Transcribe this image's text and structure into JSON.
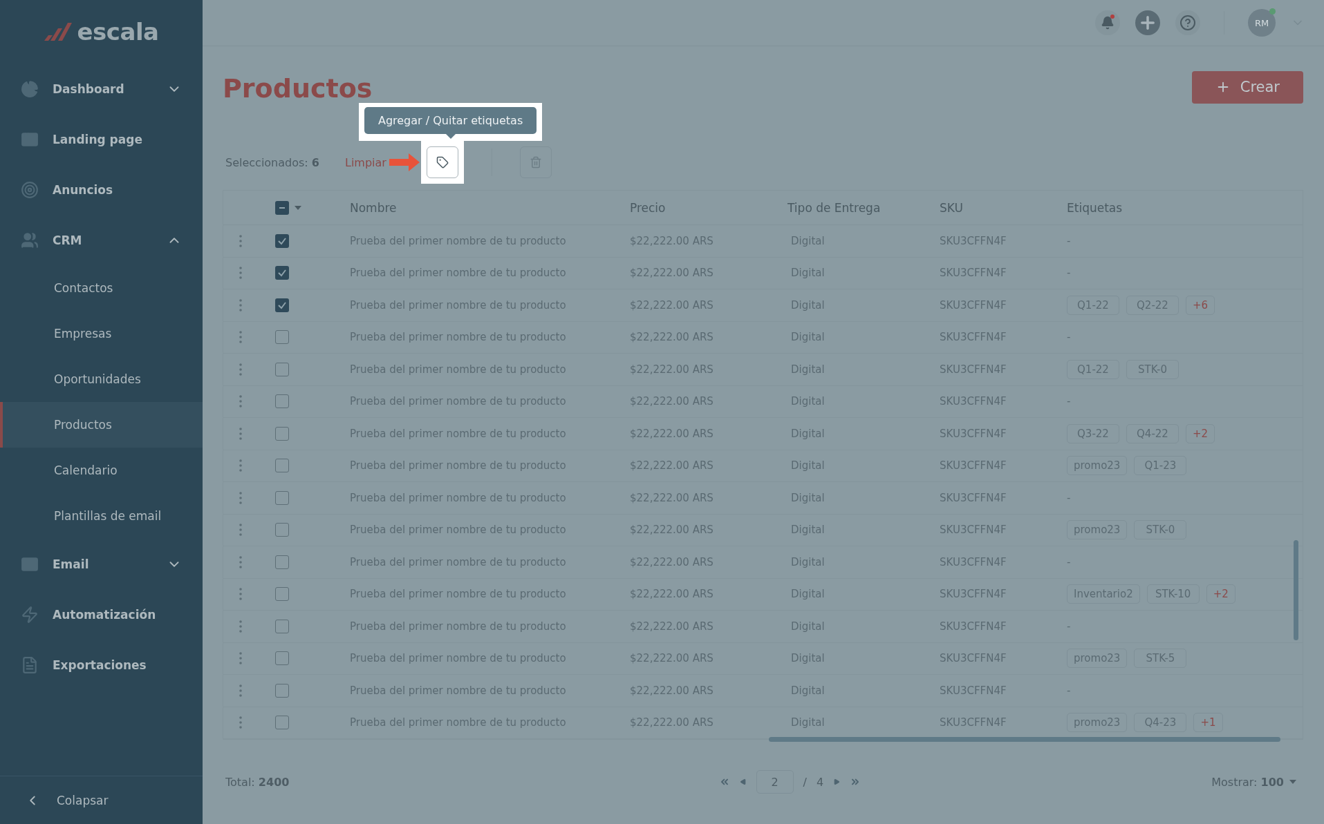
{
  "brand": {
    "name": "escala"
  },
  "sidebar": {
    "items": [
      {
        "label": "Dashboard",
        "expanded": false
      },
      {
        "label": "Landing page"
      },
      {
        "label": "Anuncios"
      },
      {
        "label": "CRM",
        "expanded": true,
        "children": [
          {
            "label": "Contactos",
            "selected": false
          },
          {
            "label": "Empresas",
            "selected": false
          },
          {
            "label": "Oportunidades",
            "selected": false
          },
          {
            "label": "Productos",
            "selected": true
          },
          {
            "label": "Calendario",
            "selected": false
          },
          {
            "label": "Plantillas de email",
            "selected": false
          }
        ]
      },
      {
        "label": "Email",
        "expanded": false
      },
      {
        "label": "Automatización"
      },
      {
        "label": "Exportaciones"
      }
    ],
    "collapse": "Colapsar"
  },
  "header": {
    "notifications_unread": true,
    "avatar": "RM",
    "online": true
  },
  "page": {
    "title": "Productos",
    "create_button": "Crear"
  },
  "selection": {
    "label": "Seleccionados:",
    "count": "6",
    "clear": "Limpiar",
    "tooltip": "Agregar / Quitar etiquetas"
  },
  "table": {
    "partially_selected": true,
    "columns": [
      "Nombre",
      "Precio",
      "Tipo de Entrega",
      "SKU",
      "Etiquetas"
    ],
    "rows": [
      {
        "selected": true,
        "name": "Prueba del primer nombre de tu producto",
        "price": "$22,222.00 ARS",
        "delivery": "Digital",
        "sku": "SKU3CFFN4F",
        "no_tags": "-"
      },
      {
        "selected": true,
        "name": "Prueba del primer nombre de tu producto",
        "price": "$22,222.00 ARS",
        "delivery": "Digital",
        "sku": "SKU3CFFN4F",
        "no_tags": "-"
      },
      {
        "selected": true,
        "name": "Prueba del primer nombre de tu producto",
        "price": "$22,222.00 ARS",
        "delivery": "Digital",
        "sku": "SKU3CFFN4F",
        "tags": [
          {
            "label": "Q1-22",
            "kind": "tag"
          },
          {
            "label": "Q2-22",
            "kind": "tag"
          },
          {
            "label": "+6",
            "kind": "more"
          }
        ]
      },
      {
        "selected": false,
        "name": "Prueba del primer nombre de tu producto",
        "price": "$22,222.00 ARS",
        "delivery": "Digital",
        "sku": "SKU3CFFN4F",
        "no_tags": "-"
      },
      {
        "selected": false,
        "name": "Prueba del primer nombre de tu producto",
        "price": "$22,222.00 ARS",
        "delivery": "Digital",
        "sku": "SKU3CFFN4F",
        "tags": [
          {
            "label": "Q1-22",
            "kind": "tag"
          },
          {
            "label": "STK-0",
            "kind": "tag"
          }
        ]
      },
      {
        "selected": false,
        "name": "Prueba del primer nombre de tu producto",
        "price": "$22,222.00 ARS",
        "delivery": "Digital",
        "sku": "SKU3CFFN4F",
        "no_tags": "-"
      },
      {
        "selected": false,
        "name": "Prueba del primer nombre de tu producto",
        "price": "$22,222.00 ARS",
        "delivery": "Digital",
        "sku": "SKU3CFFN4F",
        "tags": [
          {
            "label": "Q3-22",
            "kind": "tag"
          },
          {
            "label": "Q4-22",
            "kind": "tag"
          },
          {
            "label": "+2",
            "kind": "more"
          }
        ]
      },
      {
        "selected": false,
        "name": "Prueba del primer nombre de tu producto",
        "price": "$22,222.00 ARS",
        "delivery": "Digital",
        "sku": "SKU3CFFN4F",
        "tags": [
          {
            "label": "promo23",
            "kind": "tag"
          },
          {
            "label": "Q1-23",
            "kind": "tag"
          }
        ]
      },
      {
        "selected": false,
        "name": "Prueba del primer nombre de tu producto",
        "price": "$22,222.00 ARS",
        "delivery": "Digital",
        "sku": "SKU3CFFN4F",
        "no_tags": "-"
      },
      {
        "selected": false,
        "name": "Prueba del primer nombre de tu producto",
        "price": "$22,222.00 ARS",
        "delivery": "Digital",
        "sku": "SKU3CFFN4F",
        "tags": [
          {
            "label": "promo23",
            "kind": "tag"
          },
          {
            "label": "STK-0",
            "kind": "tag"
          }
        ]
      },
      {
        "selected": false,
        "name": "Prueba del primer nombre de tu producto",
        "price": "$22,222.00 ARS",
        "delivery": "Digital",
        "sku": "SKU3CFFN4F",
        "no_tags": "-"
      },
      {
        "selected": false,
        "name": "Prueba del primer nombre de tu producto",
        "price": "$22,222.00 ARS",
        "delivery": "Digital",
        "sku": "SKU3CFFN4F",
        "tags": [
          {
            "label": "Inventario2",
            "kind": "tag"
          },
          {
            "label": "STK-10",
            "kind": "tag"
          },
          {
            "label": "+2",
            "kind": "more"
          }
        ]
      },
      {
        "selected": false,
        "name": "Prueba del primer nombre de tu producto",
        "price": "$22,222.00 ARS",
        "delivery": "Digital",
        "sku": "SKU3CFFN4F",
        "no_tags": "-"
      },
      {
        "selected": false,
        "name": "Prueba del primer nombre de tu producto",
        "price": "$22,222.00 ARS",
        "delivery": "Digital",
        "sku": "SKU3CFFN4F",
        "tags": [
          {
            "label": "promo23",
            "kind": "tag"
          },
          {
            "label": "STK-5",
            "kind": "tag"
          }
        ]
      },
      {
        "selected": false,
        "name": "Prueba del primer nombre de tu producto",
        "price": "$22,222.00 ARS",
        "delivery": "Digital",
        "sku": "SKU3CFFN4F",
        "no_tags": "-"
      },
      {
        "selected": false,
        "name": "Prueba del primer nombre de tu producto",
        "price": "$22,222.00 ARS",
        "delivery": "Digital",
        "sku": "SKU3CFFN4F",
        "tags": [
          {
            "label": "promo23",
            "kind": "tag"
          },
          {
            "label": "Q4-23",
            "kind": "tag"
          },
          {
            "label": "+1",
            "kind": "more"
          }
        ]
      }
    ]
  },
  "footer": {
    "total_label": "Total:",
    "total": "2400",
    "page": "2",
    "separator": "/",
    "pages": "4",
    "show_label": "Mostrar:",
    "show": "100"
  }
}
